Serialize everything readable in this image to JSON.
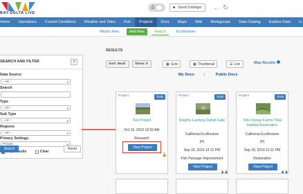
{
  "header": {
    "logo_text": "BAY-DELTA LIVE",
    "user_name": "Sarah Dollaiger",
    "logo_colors": [
      "#e2242a",
      "#3b8dd0",
      "#7cb342",
      "#f4a100"
    ]
  },
  "navbar": {
    "items": [
      "Home",
      "Operations",
      "Current Conditions",
      "Weather and Tides",
      "Fish",
      "Projects",
      "Docs",
      "Maps",
      "Wiki",
      "Workgroups",
      "Data Catalog",
      "Explore Data",
      "Li"
    ]
  },
  "subnav": {
    "items": [
      "What's New",
      "Add New",
      "Search",
      "EcoRestore"
    ]
  },
  "sidebar": {
    "title": "SEARCH AND FILTER",
    "help": "?",
    "data_source_label": "Data Source",
    "data_source_value": "--All --",
    "search_label": "Search",
    "type_label": "Type",
    "type_value": "--All --",
    "subtype_label": "Sub Type",
    "subtype_value": "--All --",
    "regions_label": "Regions",
    "regions_value": "--All --",
    "privacy_label": "Privacy Settings",
    "privacy_value": "Private",
    "map_results_label": "Map Results",
    "clear_label": "Clear",
    "search_button": "Search",
    "reset_button": "Reset"
  },
  "results": {
    "label": "RESULTS",
    "sort_value": "Sort: Modi",
    "show_value": "Show: 6",
    "grid_label": "Grid",
    "thumbnail_label": "Thumbnail",
    "list_label": "List",
    "map_results": "Map Results",
    "my_docs": "My Docs",
    "separator": "|",
    "public_docs": "Public Docs"
  },
  "cards": [
    {
      "type": "Project",
      "tools": "Tools",
      "title": "Test Project",
      "org": "",
      "tag": "",
      "date": "Oct 16, 2019 10:33 AM",
      "category": "Research",
      "button": "View Project"
    },
    {
      "type": "Project",
      "tools": "Tools",
      "title": "Knights Landing Outfall Gate",
      "org": "California EcoRestore",
      "tag": "(P)",
      "date": "Sep 18, 2019 12:12 PM",
      "category": "Fish Passage Improvement",
      "button": "View Project"
    },
    {
      "type": "Project",
      "tools": "Tools",
      "title": "Yolo Flyway Farms Tidal Habitat Restoration",
      "org": "California EcoRestore",
      "tag": "(P)",
      "date": "Sep 18, 2019 12:11 PM",
      "category": "Restoration",
      "button": "View Project"
    }
  ]
}
